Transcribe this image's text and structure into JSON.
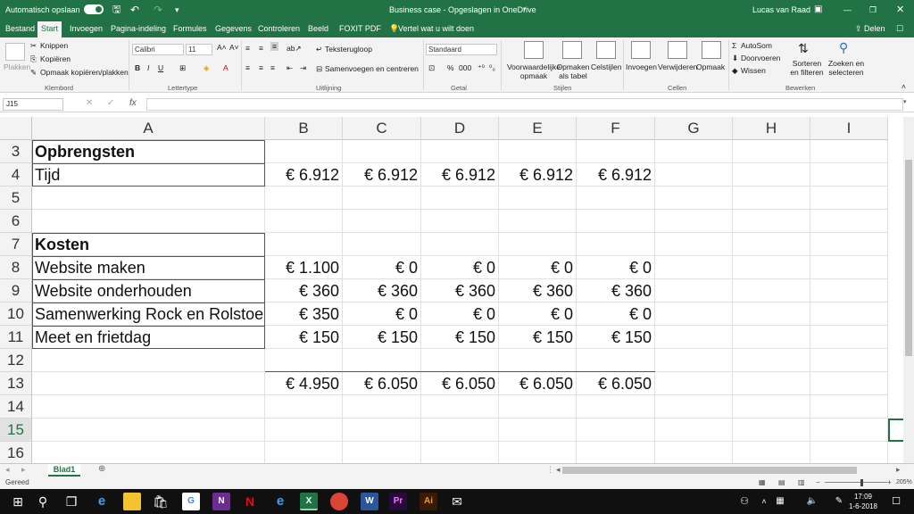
{
  "titlebar": {
    "autosave_label": "Automatisch opslaan",
    "document_title": "Business case  -  Opgeslagen in OneDrive",
    "user_name": "Lucas van Raad"
  },
  "menu": {
    "tabs": [
      "Bestand",
      "Start",
      "Invoegen",
      "Pagina-indeling",
      "Formules",
      "Gegevens",
      "Controleren",
      "Beeld",
      "FOXIT PDF"
    ],
    "tell_me": "Vertel wat u wilt doen",
    "share": "Delen"
  },
  "ribbon": {
    "clipboard": {
      "paste": "Plakken",
      "cut": "Knippen",
      "copy": "Kopiëren",
      "format_painter": "Opmaak kopiëren/plakken",
      "group": "Klembord"
    },
    "font": {
      "family": "Calibri",
      "size": "11",
      "group": "Lettertype"
    },
    "alignment": {
      "wrap": "Teksterugloop",
      "merge": "Samenvoegen en centreren",
      "group": "Uitlijning"
    },
    "number": {
      "format": "Standaard",
      "group": "Getal"
    },
    "styles": {
      "conditional": "Voorwaardelijke opmaak",
      "as_table": "Opmaken als tabel",
      "cell_styles": "Celstijlen",
      "group": "Stijlen"
    },
    "cells": {
      "insert": "Invoegen",
      "delete": "Verwijderen",
      "format": "Opmaak",
      "group": "Cellen"
    },
    "editing": {
      "autosum": "AutoSom",
      "fill": "Doorvoeren",
      "clear": "Wissen",
      "sort": "Sorteren en filteren",
      "find": "Zoeken en selecteren",
      "group": "Bewerken"
    }
  },
  "formula_bar": {
    "name_box": "J15",
    "fx": "fx"
  },
  "columns": [
    "A",
    "B",
    "C",
    "D",
    "E",
    "F",
    "G",
    "H",
    "I"
  ],
  "rows": [
    {
      "num": "3",
      "cells": [
        "Opbrengsten",
        "",
        "",
        "",
        "",
        ""
      ]
    },
    {
      "num": "4",
      "cells": [
        "Tijd",
        "€ 6.912",
        "€ 6.912",
        "€ 6.912",
        "€ 6.912",
        "€ 6.912"
      ]
    },
    {
      "num": "5",
      "cells": [
        "",
        "",
        "",
        "",
        "",
        ""
      ]
    },
    {
      "num": "6",
      "cells": [
        "",
        "",
        "",
        "",
        "",
        ""
      ]
    },
    {
      "num": "7",
      "cells": [
        "Kosten",
        "",
        "",
        "",
        "",
        ""
      ]
    },
    {
      "num": "8",
      "cells": [
        "Website maken",
        "€ 1.100",
        "€ 0",
        "€ 0",
        "€ 0",
        "€ 0"
      ]
    },
    {
      "num": "9",
      "cells": [
        "Website onderhouden",
        "€ 360",
        "€ 360",
        "€ 360",
        "€ 360",
        "€ 360"
      ]
    },
    {
      "num": "10",
      "cells": [
        "Samenwerking Rock en Rolstoe",
        "€ 350",
        "€ 0",
        "€ 0",
        "€ 0",
        "€ 0"
      ]
    },
    {
      "num": "11",
      "cells": [
        "Meet en frietdag",
        "€ 150",
        "€ 150",
        "€ 150",
        "€ 150",
        "€ 150"
      ]
    },
    {
      "num": "12",
      "cells": [
        "",
        "",
        "",
        "",
        "",
        ""
      ]
    },
    {
      "num": "13",
      "cells": [
        "",
        "€ 4.950",
        "€ 6.050",
        "€ 6.050",
        "€ 6.050",
        "€ 6.050"
      ]
    },
    {
      "num": "14",
      "cells": [
        "",
        "",
        "",
        "",
        "",
        ""
      ]
    },
    {
      "num": "15",
      "cells": [
        "",
        "",
        "",
        "",
        "",
        ""
      ]
    },
    {
      "num": "16",
      "cells": [
        "",
        "",
        "",
        "",
        "",
        ""
      ]
    }
  ],
  "sheet_tabs": [
    "Blad1"
  ],
  "status": {
    "ready": "Gereed",
    "zoom": "205%"
  },
  "taskbar": {
    "time": "17:09",
    "date": "1-6-2018"
  },
  "colors": {
    "excel_green": "#217346"
  }
}
